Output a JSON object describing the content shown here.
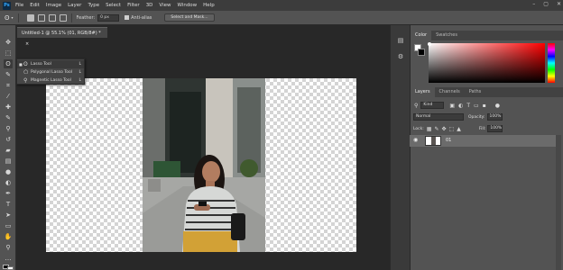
{
  "menubar": {
    "logo": "Ps",
    "items": [
      "File",
      "Edit",
      "Image",
      "Layer",
      "Type",
      "Select",
      "Filter",
      "3D",
      "View",
      "Window",
      "Help"
    ],
    "window_controls": [
      "–",
      "▢",
      "✕"
    ]
  },
  "options": {
    "tool_glyph": "ʘ",
    "feather_label": "Feather:",
    "feather_value": "0 px",
    "antialias_label": "Anti-alias",
    "select_mask_label": "Select and Mask..."
  },
  "document": {
    "tab_title": "Untitled-1 @ 55.1% (01, RGB/8#) *",
    "close_glyph": "×"
  },
  "toolbar": {
    "tools": [
      {
        "name": "move-tool-icon",
        "glyph": "✥"
      },
      {
        "name": "marquee-tool-icon",
        "glyph": "⬚"
      },
      {
        "name": "lasso-tool-icon",
        "glyph": "ʘ"
      },
      {
        "name": "quick-select-tool-icon",
        "glyph": "✎"
      },
      {
        "name": "crop-tool-icon",
        "glyph": "⌗"
      },
      {
        "name": "eyedropper-tool-icon",
        "glyph": "⁄"
      },
      {
        "name": "healing-tool-icon",
        "glyph": "✚"
      },
      {
        "name": "brush-tool-icon",
        "glyph": "✎"
      },
      {
        "name": "stamp-tool-icon",
        "glyph": "⚲"
      },
      {
        "name": "history-brush-tool-icon",
        "glyph": "↺"
      },
      {
        "name": "eraser-tool-icon",
        "glyph": "▰"
      },
      {
        "name": "gradient-tool-icon",
        "glyph": "▤"
      },
      {
        "name": "blur-tool-icon",
        "glyph": "●"
      },
      {
        "name": "dodge-tool-icon",
        "glyph": "◐"
      },
      {
        "name": "pen-tool-icon",
        "glyph": "✒"
      },
      {
        "name": "type-tool-icon",
        "glyph": "T"
      },
      {
        "name": "path-select-tool-icon",
        "glyph": "➤"
      },
      {
        "name": "shape-tool-icon",
        "glyph": "▭"
      },
      {
        "name": "hand-tool-icon",
        "glyph": "✋"
      },
      {
        "name": "zoom-tool-icon",
        "glyph": "⚲"
      },
      {
        "name": "more-tools-icon",
        "glyph": "…"
      }
    ],
    "fg_color": "#000000",
    "bg_color": "#ffffff"
  },
  "flyout": {
    "items": [
      {
        "label": "Lasso Tool",
        "key": "L",
        "glyph": "ʘ",
        "bullet": "■"
      },
      {
        "label": "Polygonal Lasso Tool",
        "key": "L",
        "glyph": "⬠",
        "bullet": ""
      },
      {
        "label": "Magnetic Lasso Tool",
        "key": "L",
        "glyph": "⚲",
        "bullet": ""
      }
    ]
  },
  "panels": {
    "color_tabs": [
      "Color",
      "Swatches"
    ],
    "layers_tabs": [
      "Layers",
      "Channels",
      "Paths"
    ],
    "kind_label": "Kind",
    "blend_mode": "Normal",
    "opacity_label": "Opacity:",
    "opacity_value": "100%",
    "lock_label": "Lock:",
    "fill_label": "Fill:",
    "fill_value": "100%",
    "layer": {
      "name": "01",
      "eye": "◉"
    }
  },
  "colors": {
    "accent": "#31a8ff",
    "panel_bg": "#535353",
    "canvas_bg": "#282828"
  }
}
